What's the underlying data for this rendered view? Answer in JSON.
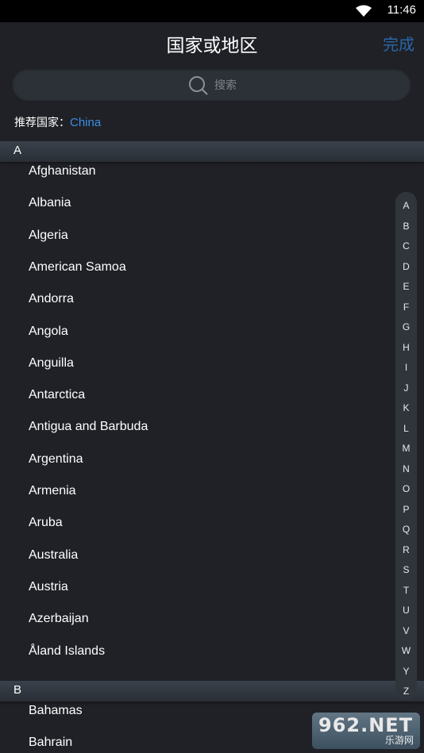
{
  "status_bar": {
    "time": "11:46"
  },
  "header": {
    "title": "国家或地区",
    "done_label": "完成"
  },
  "search": {
    "placeholder": "搜索"
  },
  "recommend": {
    "label": "推荐国家：",
    "country": "China"
  },
  "sections": [
    {
      "letter": "A",
      "countries": [
        "Afghanistan",
        "Albania",
        "Algeria",
        "American Samoa",
        "Andorra",
        "Angola",
        "Anguilla",
        "Antarctica",
        "Antigua and Barbuda",
        "Argentina",
        "Armenia",
        "Aruba",
        "Australia",
        "Austria",
        "Azerbaijan",
        "Åland Islands"
      ]
    },
    {
      "letter": "B",
      "countries": [
        "Bahamas",
        "Bahrain"
      ]
    }
  ],
  "index_letters": [
    "A",
    "B",
    "C",
    "D",
    "E",
    "F",
    "G",
    "H",
    "I",
    "J",
    "K",
    "L",
    "M",
    "N",
    "O",
    "P",
    "Q",
    "R",
    "S",
    "T",
    "U",
    "V",
    "W",
    "Y",
    "Z"
  ],
  "watermark": {
    "line1": "962.NET",
    "line2": "乐游网"
  },
  "colors": {
    "background": "#1f2126",
    "accent": "#3b8fe4",
    "done": "#2a66a8"
  }
}
